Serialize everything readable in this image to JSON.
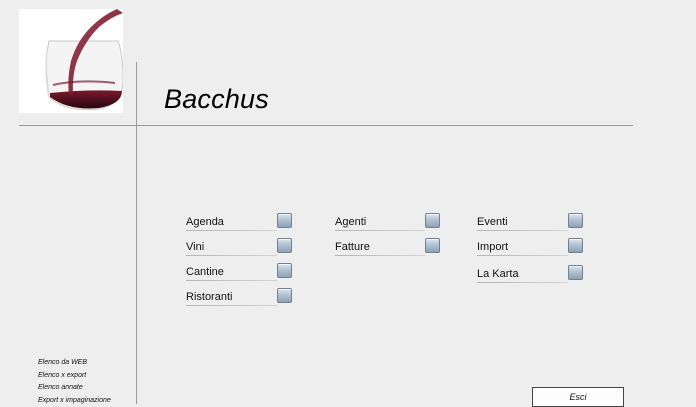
{
  "app": {
    "title": "Bacchus"
  },
  "menu": {
    "columns": [
      [
        {
          "label": "Agenda",
          "key": "agenda"
        },
        {
          "label": "Vini",
          "key": "vini"
        },
        {
          "label": "Cantine",
          "key": "cantine"
        },
        {
          "label": "Ristoranti",
          "key": "ristoranti"
        }
      ],
      [
        {
          "label": "Agenti",
          "key": "agenti"
        },
        {
          "label": "Fatture",
          "key": "fatture"
        }
      ],
      [
        {
          "label": "Eventi",
          "key": "eventi"
        },
        {
          "label": "Import",
          "key": "import"
        },
        {
          "label": "La Karta",
          "key": "la-karta"
        }
      ]
    ]
  },
  "left_links": [
    "Elenco da WEB",
    "Elenco x export",
    "Elenco annate",
    "Export x impaginazione"
  ],
  "buttons": {
    "exit_label": "Esci"
  },
  "colors": {
    "background": "#eeeeee",
    "wine": "#5a0d1c",
    "divider": "#9a9a9a"
  },
  "icons": {
    "logo": "wine-glass-icon",
    "menu_button": "square-button-icon"
  }
}
